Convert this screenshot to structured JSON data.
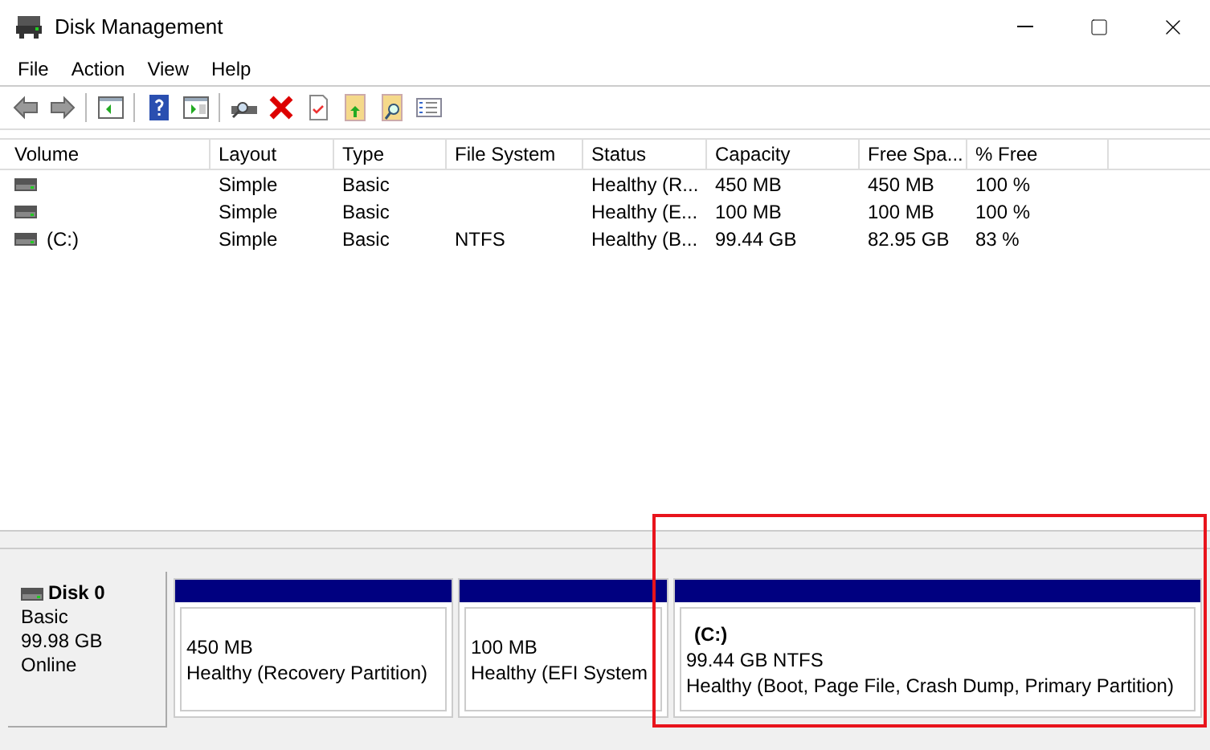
{
  "window": {
    "title": "Disk Management"
  },
  "menu": [
    "File",
    "Action",
    "View",
    "Help"
  ],
  "table": {
    "columns": [
      "Volume",
      "Layout",
      "Type",
      "File System",
      "Status",
      "Capacity",
      "Free Spa...",
      "% Free"
    ],
    "rows": [
      {
        "cells": [
          "",
          "Simple",
          "Basic",
          "",
          "Healthy (R...",
          "450 MB",
          "450 MB",
          "100 %"
        ]
      },
      {
        "cells": [
          "",
          "Simple",
          "Basic",
          "",
          "Healthy (E...",
          "100 MB",
          "100 MB",
          "100 %"
        ]
      },
      {
        "cells": [
          "(C:)",
          "Simple",
          "Basic",
          "NTFS",
          "Healthy (B...",
          "99.44 GB",
          "82.95 GB",
          "83 %"
        ]
      }
    ]
  },
  "disks": [
    {
      "name": "Disk 0",
      "type": "Basic",
      "size": "99.98 GB",
      "status": "Online",
      "partitions": [
        {
          "size": "450 MB",
          "status": "Healthy (Recovery Partition)"
        },
        {
          "size": "100 MB",
          "status": "Healthy (EFI System"
        },
        {
          "label": "(C:)",
          "size": "99.44 GB NTFS",
          "status": "Healthy (Boot, Page File, Crash Dump, Primary Partition)"
        }
      ]
    }
  ]
}
